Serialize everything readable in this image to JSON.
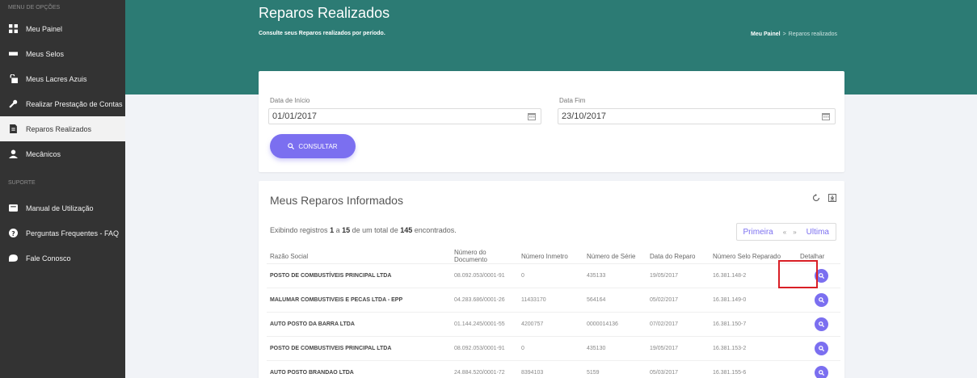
{
  "sidebar": {
    "menu_heading": "MENU DE OPÇÕES",
    "support_heading": "SUPORTE",
    "items": [
      {
        "label": "Meu Painel",
        "icon": "dashboard-icon"
      },
      {
        "label": "Meus Selos",
        "icon": "seal-icon"
      },
      {
        "label": "Meus Lacres Azuis",
        "icon": "lock-icon"
      },
      {
        "label": "Realizar Prestação de Contas",
        "icon": "wrench-icon"
      },
      {
        "label": "Reparos Realizados",
        "icon": "document-icon",
        "active": true
      },
      {
        "label": "Mecânicos",
        "icon": "user-icon"
      }
    ],
    "support_items": [
      {
        "label": "Manual de Utilização",
        "icon": "book-icon"
      },
      {
        "label": "Perguntas Frequentes - FAQ",
        "icon": "question-icon"
      },
      {
        "label": "Fale Conosco",
        "icon": "chat-icon"
      }
    ]
  },
  "header": {
    "title": "Reparos Realizados",
    "subtitle": "Consulte seus Reparos realizados por período.",
    "breadcrumb_home": "Meu Painel",
    "breadcrumb_separator": ">",
    "breadcrumb_current": "Reparos realizados"
  },
  "filter": {
    "start_label": "Data de Início",
    "start_value": "01/01/2017",
    "end_label": "Data Fim",
    "end_value": "23/10/2017",
    "button_label": "CONSULTAR"
  },
  "results": {
    "title": "Meus Reparos Informados",
    "info_prefix": "Exibindo registros",
    "info_from": "1",
    "info_a": "a",
    "info_to": "15",
    "info_mid": "de um total de",
    "info_total": "145",
    "info_suffix": "encontrados.",
    "pager": {
      "first": "Primeira",
      "prev": "«",
      "next": "»",
      "last": "Ultima"
    },
    "columns": [
      "Razão Social",
      "Número do Documento",
      "Número Inmetro",
      "Número de Série",
      "Data do Reparo",
      "Número Selo Reparado",
      "Detalhar"
    ],
    "rows": [
      [
        "POSTO DE COMBUSTÍVEIS PRINCIPAL LTDA",
        "08.092.053/0001-91",
        "0",
        "435133",
        "19/05/2017",
        "16.381.148-2"
      ],
      [
        "MALUMAR COMBUSTIVEIS E PECAS LTDA - EPP",
        "04.283.686/0001-26",
        "11433170",
        "564164",
        "05/02/2017",
        "16.381.149-0"
      ],
      [
        "AUTO POSTO DA BARRA LTDA",
        "01.144.245/0001-55",
        "4200757",
        "0000014136",
        "07/02/2017",
        "16.381.150-7"
      ],
      [
        "POSTO DE COMBUSTIVEIS PRINCIPAL LTDA",
        "08.092.053/0001-91",
        "0",
        "435130",
        "19/05/2017",
        "16.381.153-2"
      ],
      [
        "AUTO POSTO BRANDAO LTDA",
        "24.884.520/0001-72",
        "8394103",
        "5159",
        "05/03/2017",
        "16.381.155-6"
      ]
    ]
  },
  "colors": {
    "sidebar_bg": "#333333",
    "header_bg": "#2c7b74",
    "accent": "#7b6ff0",
    "highlight": "#d91f26"
  }
}
